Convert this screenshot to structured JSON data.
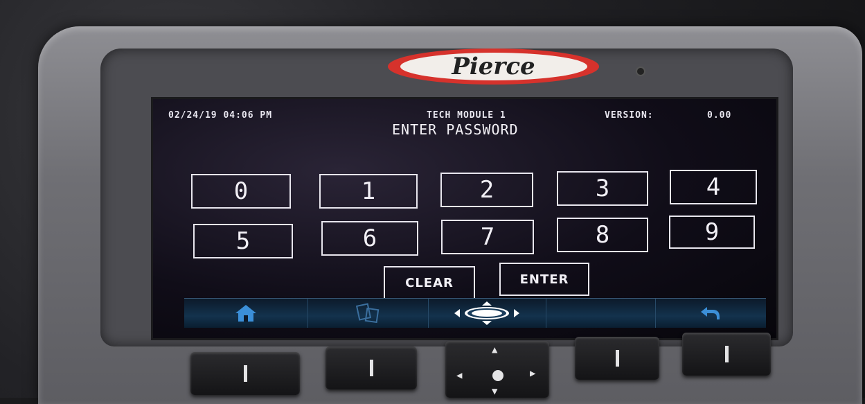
{
  "device": {
    "brand_logo": "Pierce"
  },
  "screen": {
    "datetime": "02/24/19 04:06 PM",
    "module": "TECH MODULE 1",
    "version_label": "VERSION:",
    "version_value": "0.00",
    "title": "ENTER PASSWORD",
    "keypad": [
      "0",
      "1",
      "2",
      "3",
      "4",
      "5",
      "6",
      "7",
      "8",
      "9"
    ],
    "clear_label": "CLEAR",
    "enter_label": "ENTER"
  },
  "softkeys": [
    {
      "icon": "home-icon"
    },
    {
      "icon": "pages-icon"
    },
    {
      "icon": "pierce-nav-icon"
    },
    {
      "icon": "blank"
    },
    {
      "icon": "back-arrow-icon"
    }
  ],
  "colors": {
    "logo_red": "#d6322c",
    "screen_bg": "#100d18",
    "softbar_blue": "#13324d",
    "icon_blue": "#3b8fd8"
  }
}
